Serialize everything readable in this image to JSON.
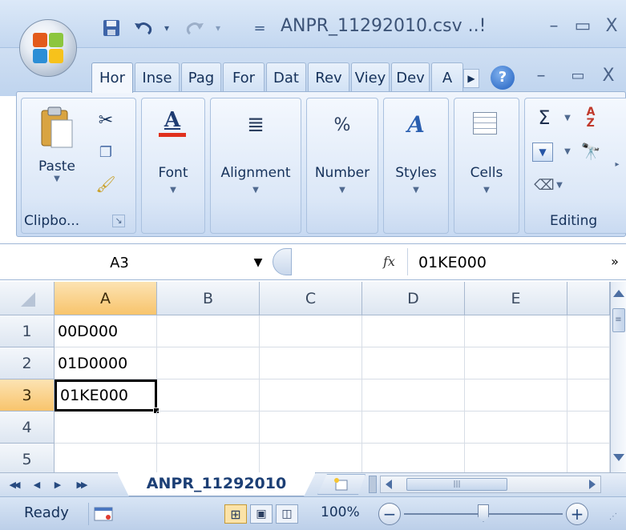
{
  "window": {
    "title": "ANPR_11292010.csv ..!",
    "minimize": "–",
    "maximize": "▭",
    "close": "X",
    "ribbon_minimize": "–",
    "ribbon_restore": "▭",
    "ribbon_close": "X"
  },
  "quick_access": {
    "save_icon": "save-icon",
    "undo_icon": "undo-icon",
    "redo_icon": "redo-icon",
    "customize_label": "="
  },
  "tabs": [
    "Hor",
    "Inse",
    "Pag",
    "For",
    "Dat",
    "Rev",
    "Viey",
    "Dev",
    "A"
  ],
  "ribbon": {
    "clipboard": {
      "paste_label": "Paste",
      "group_label": "Clipbo...",
      "dialog_launcher": "↘"
    },
    "font": {
      "label": "Font"
    },
    "alignment": {
      "label": "Alignment"
    },
    "number": {
      "label": "Number",
      "icon_text": "%"
    },
    "styles": {
      "label": "Styles"
    },
    "cells": {
      "label": "Cells"
    },
    "editing": {
      "label": "Editing",
      "sum_icon": "Σ"
    }
  },
  "formula_bar": {
    "name_box": "A3",
    "fx": "fx",
    "value": "01KE000"
  },
  "grid": {
    "columns": [
      "A",
      "B",
      "C",
      "D",
      "E"
    ],
    "rows": [
      {
        "num": "1",
        "cells": [
          "00D000",
          "",
          "",
          "",
          ""
        ]
      },
      {
        "num": "2",
        "cells": [
          "01D0000",
          "",
          "",
          "",
          ""
        ]
      },
      {
        "num": "3",
        "cells": [
          "01KE000",
          "",
          "",
          "",
          ""
        ]
      },
      {
        "num": "4",
        "cells": [
          "",
          "",
          "",
          "",
          ""
        ]
      },
      {
        "num": "5",
        "cells": [
          "",
          "",
          "",
          "",
          ""
        ]
      }
    ],
    "selected_cell": "A3"
  },
  "sheet_tabs": {
    "active": "ANPR_11292010",
    "nav_first": "◀◀",
    "nav_prev": "◀",
    "nav_next": "▶",
    "nav_last": "▶▶"
  },
  "status": {
    "ready": "Ready",
    "zoom": "100%",
    "zoom_out": "−",
    "zoom_in": "+"
  },
  "colors": {
    "accent": "#f8c46c",
    "ribbon_bg": "#d6e4f6",
    "font_underline": "#e0301e"
  }
}
